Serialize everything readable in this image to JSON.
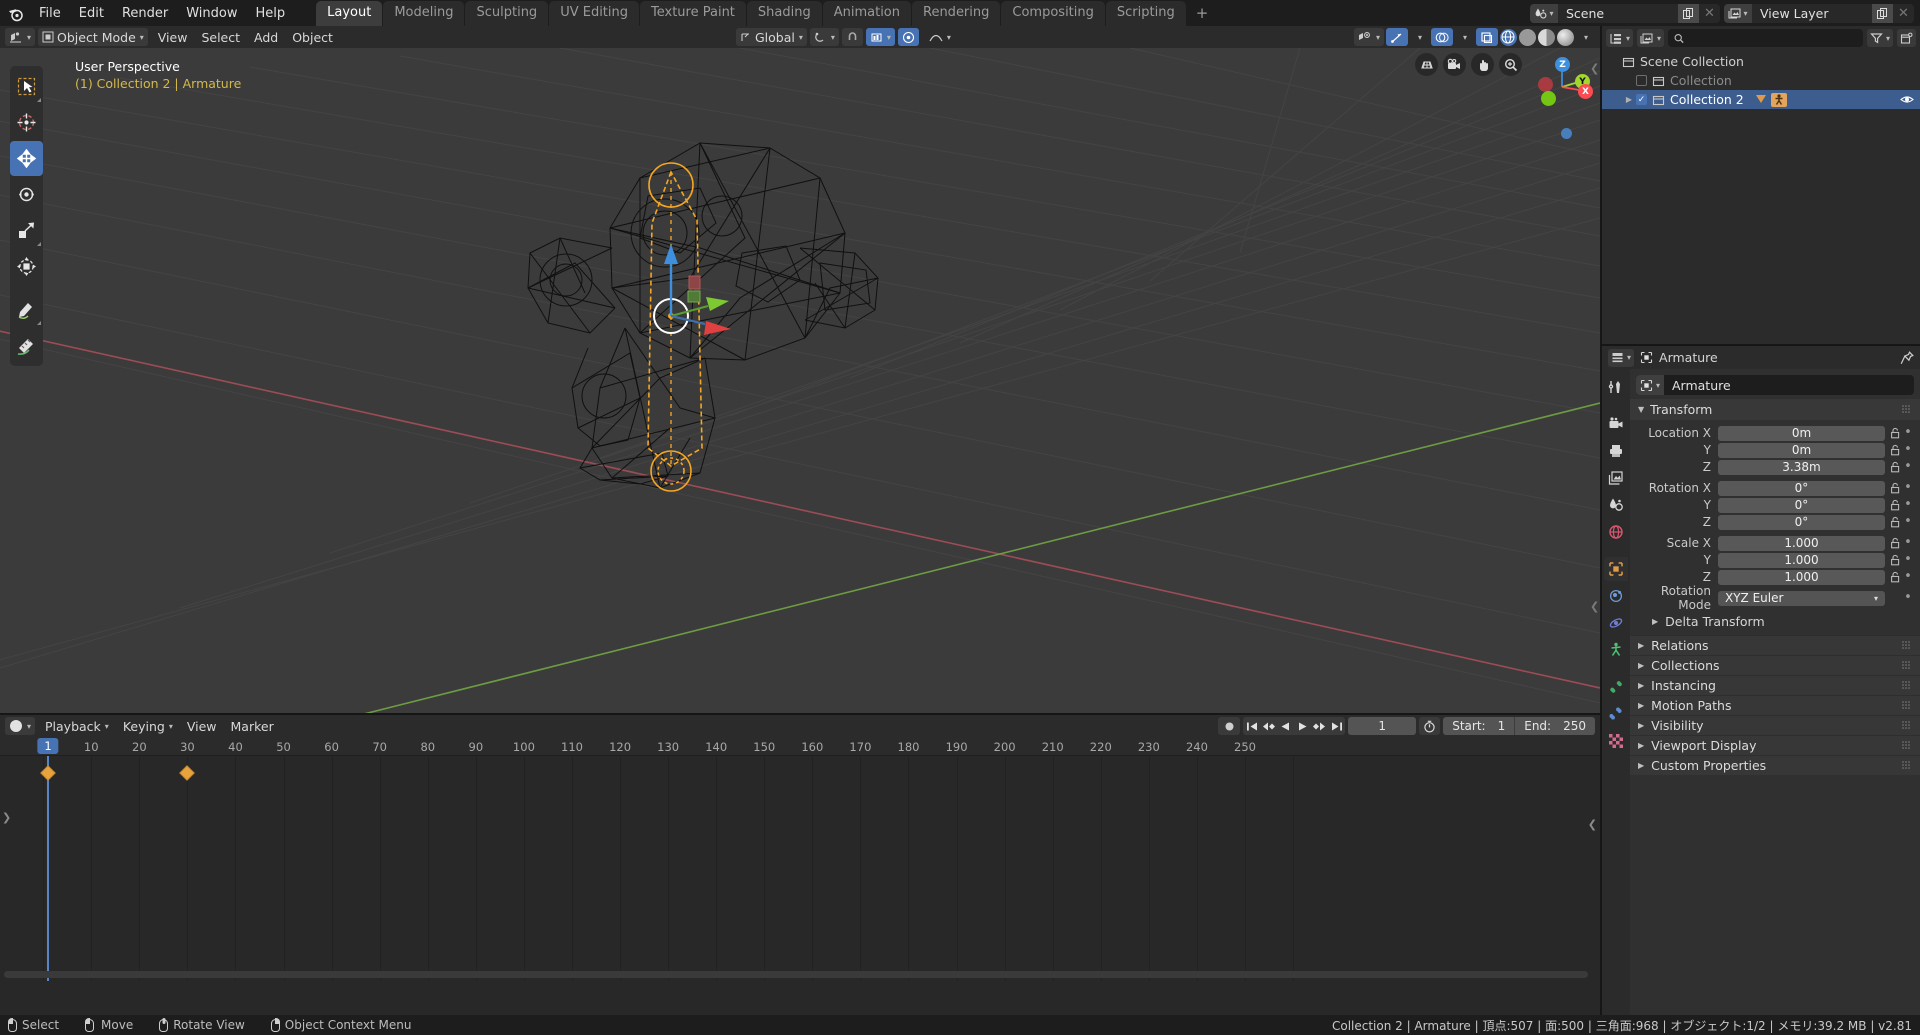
{
  "topbar": {
    "menus": [
      "File",
      "Edit",
      "Render",
      "Window",
      "Help"
    ],
    "workspaces": [
      {
        "label": "Layout",
        "active": true
      },
      {
        "label": "Modeling",
        "active": false
      },
      {
        "label": "Sculpting",
        "active": false
      },
      {
        "label": "UV Editing",
        "active": false
      },
      {
        "label": "Texture Paint",
        "active": false
      },
      {
        "label": "Shading",
        "active": false
      },
      {
        "label": "Animation",
        "active": false
      },
      {
        "label": "Rendering",
        "active": false
      },
      {
        "label": "Compositing",
        "active": false
      },
      {
        "label": "Scripting",
        "active": false
      }
    ],
    "add_workspace": "+",
    "scene_name": "Scene",
    "view_layer_name": "View Layer"
  },
  "viewport_header": {
    "mode": "Object Mode",
    "menus": [
      "View",
      "Select",
      "Add",
      "Object"
    ],
    "transform_orientation": "Global",
    "snap_label": "",
    "proportional_label": ""
  },
  "viewport": {
    "perspective_label": "User Perspective",
    "collection_label": "(1) Collection 2 | Armature",
    "axis_labels": {
      "z": "Z",
      "y": "Y",
      "x": "X"
    },
    "axis_colors": {
      "x": "#fc4c52",
      "y": "#a2d72d",
      "z": "#3e8fde"
    },
    "grid_color": "#4a4a4a",
    "x_axis_line": "#9b4a52",
    "y_axis_line": "#6a9b3f",
    "bone_color": "#f5a623",
    "tools": [
      "tweak-select-tool",
      "cursor-tool",
      "move-tool",
      "rotate-tool",
      "scale-tool",
      "transform-tool",
      "annotate-tool",
      "measure-tool"
    ],
    "nav_buttons": [
      "toggle-ortho-persp",
      "camera-view",
      "pan-view",
      "zoom-view"
    ]
  },
  "outliner": {
    "display_mode": "View Layer",
    "search_placeholder": "",
    "search_value": "",
    "rows": [
      {
        "label": "Scene Collection",
        "indent": 0,
        "selected": false,
        "dim": false,
        "checkbox": null,
        "disclosure": false
      },
      {
        "label": "Collection",
        "indent": 1,
        "selected": false,
        "dim": true,
        "checkbox": false,
        "disclosure": false
      },
      {
        "label": "Collection 2",
        "indent": 1,
        "selected": true,
        "dim": false,
        "checkbox": true,
        "disclosure": true
      }
    ],
    "filter_icon": "filter-icon",
    "new_collection_icon": "new-collection-icon"
  },
  "properties": {
    "breadcrumb_object": "Armature",
    "object_name": "Armature",
    "pin_icon": "pin-icon",
    "tabs": [
      "tool-tab",
      "render-tab",
      "output-tab",
      "view-layer-tab",
      "scene-tab",
      "world-tab",
      "object-tab",
      "modifier-tab",
      "physics-tab",
      "object-constraint-tab",
      "object-data-tab",
      "bone-tab",
      "texture-tab"
    ],
    "active_tab_index": 6,
    "transform_panel": {
      "title": "Transform",
      "rows": [
        {
          "label": "Location X",
          "value": "0m"
        },
        {
          "label": "Y",
          "value": "0m"
        },
        {
          "label": "Z",
          "value": "3.38m"
        },
        {
          "label": "Rotation X",
          "value": "0°",
          "spaced": true
        },
        {
          "label": "Y",
          "value": "0°"
        },
        {
          "label": "Z",
          "value": "0°"
        },
        {
          "label": "Scale X",
          "value": "1.000",
          "spaced": true
        },
        {
          "label": "Y",
          "value": "1.000"
        },
        {
          "label": "Z",
          "value": "1.000"
        }
      ],
      "rotation_mode_label": "Rotation Mode",
      "rotation_mode_value": "XYZ Euler"
    },
    "sub_panel": "Delta Transform",
    "closed_panels": [
      "Relations",
      "Collections",
      "Instancing",
      "Motion Paths",
      "Visibility",
      "Viewport Display",
      "Custom Properties"
    ]
  },
  "timeline": {
    "editor_type": "timeline-editor-icon",
    "menus": [
      "Playback",
      "Keying",
      "View",
      "Marker"
    ],
    "current_frame": "1",
    "start_label": "Start:",
    "start_value": "1",
    "end_label": "End:",
    "end_value": "250",
    "ruler_ticks": [
      10,
      20,
      30,
      40,
      50,
      60,
      70,
      80,
      90,
      100,
      110,
      120,
      130,
      140,
      150,
      160,
      170,
      180,
      190,
      200,
      210,
      220,
      230,
      240,
      250
    ],
    "keyframes": [
      1,
      30
    ],
    "playhead_frame": 1,
    "frame_range": [
      0,
      256
    ]
  },
  "statusbar": {
    "hints": [
      {
        "icon": "mouse-left-icon",
        "label": "Select"
      },
      {
        "icon": "mouse-move-icon",
        "label": "Move"
      },
      {
        "icon": "mouse-middle-icon",
        "label": "Rotate View"
      },
      {
        "icon": "mouse-right-icon",
        "label": "Object Context Menu"
      }
    ],
    "scene_stats": "Collection 2 | Armature | 頂点:507 | 面:500 | 三角面:968 | オブジェクト:1/2 | メモリ:39.2 MB | v2.81"
  }
}
